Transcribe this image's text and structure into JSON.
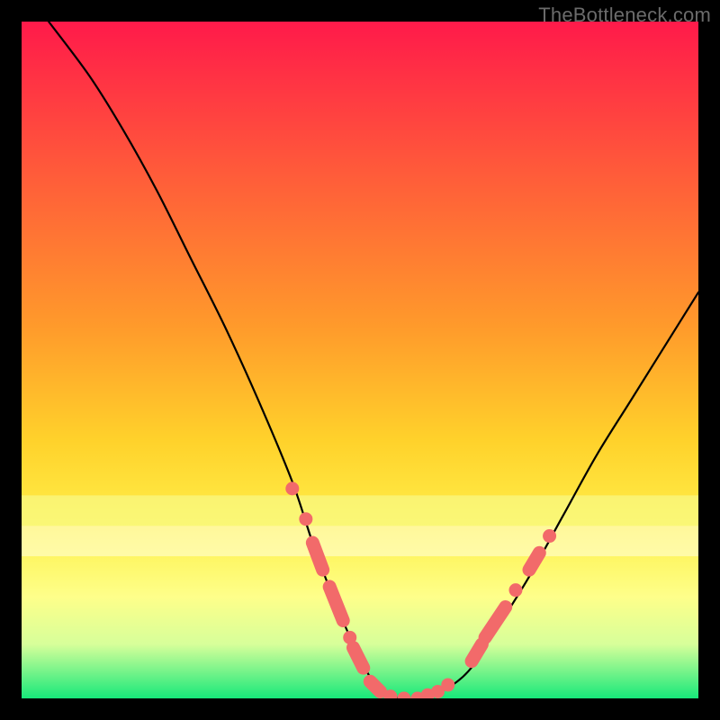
{
  "watermark": "TheBottleneck.com",
  "colors": {
    "gradient_top": "#ff1a4a",
    "gradient_mid1": "#ff8a2b",
    "gradient_mid2": "#ffe22b",
    "gradient_mid3": "#ffff66",
    "gradient_bottom_pale": "#f7ffb0",
    "gradient_green": "#17e87a",
    "curve": "#000000",
    "dot": "#f26a6a",
    "frame": "#000000"
  },
  "chart_data": {
    "type": "line",
    "title": "",
    "xlabel": "",
    "ylabel": "",
    "xlim": [
      0,
      100
    ],
    "ylim": [
      0,
      100
    ],
    "series": [
      {
        "name": "bottleneck-curve",
        "x": [
          4,
          10,
          15,
          20,
          25,
          30,
          35,
          40,
          43,
          46,
          49,
          51,
          53,
          56,
          59,
          62,
          66,
          70,
          75,
          80,
          85,
          90,
          95,
          100
        ],
        "values": [
          100,
          92,
          84,
          75,
          65,
          55,
          44,
          32,
          23,
          15,
          8,
          4,
          1,
          0,
          0,
          1,
          4,
          10,
          18,
          27,
          36,
          44,
          52,
          60
        ]
      }
    ],
    "markers": [
      {
        "kind": "dot",
        "x": 40.0,
        "y": 31.0
      },
      {
        "kind": "dot",
        "x": 42.0,
        "y": 26.5
      },
      {
        "kind": "pill",
        "x1": 43.0,
        "y1": 23.0,
        "x2": 44.5,
        "y2": 19.0
      },
      {
        "kind": "pill",
        "x1": 45.5,
        "y1": 16.5,
        "x2": 47.5,
        "y2": 11.5
      },
      {
        "kind": "dot",
        "x": 48.5,
        "y": 9.0
      },
      {
        "kind": "pill",
        "x1": 49.0,
        "y1": 7.5,
        "x2": 50.5,
        "y2": 4.5
      },
      {
        "kind": "pill",
        "x1": 51.5,
        "y1": 2.5,
        "x2": 53.0,
        "y2": 1.0
      },
      {
        "kind": "dot",
        "x": 54.5,
        "y": 0.3
      },
      {
        "kind": "dot",
        "x": 56.5,
        "y": 0.0
      },
      {
        "kind": "dot",
        "x": 58.5,
        "y": 0.0
      },
      {
        "kind": "dot",
        "x": 60.0,
        "y": 0.5
      },
      {
        "kind": "dot",
        "x": 61.5,
        "y": 1.0
      },
      {
        "kind": "dot",
        "x": 63.0,
        "y": 2.0
      },
      {
        "kind": "pill",
        "x1": 66.5,
        "y1": 5.5,
        "x2": 68.0,
        "y2": 8.0
      },
      {
        "kind": "pill",
        "x1": 68.5,
        "y1": 9.0,
        "x2": 71.5,
        "y2": 13.5
      },
      {
        "kind": "dot",
        "x": 73.0,
        "y": 16.0
      },
      {
        "kind": "pill",
        "x1": 75.0,
        "y1": 19.0,
        "x2": 76.5,
        "y2": 21.5
      },
      {
        "kind": "dot",
        "x": 78.0,
        "y": 24.0
      }
    ],
    "gradient_bands": [
      {
        "y": 25.5,
        "height": 4.5,
        "color": "#f6ff9a"
      },
      {
        "y": 21.0,
        "height": 4.5,
        "color": "#ffffe0"
      }
    ]
  }
}
